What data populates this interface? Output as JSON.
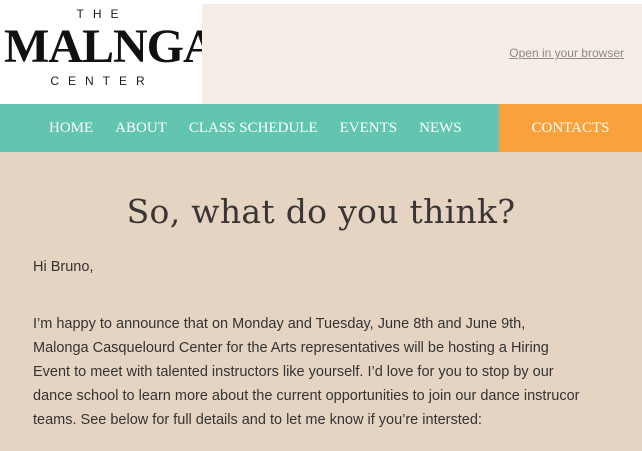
{
  "header": {
    "logo": {
      "top_text": "THE",
      "main_left": "MAL",
      "main_right": "NGA",
      "bottom_text": "CENTER"
    },
    "browser_link": "Open in your browser"
  },
  "nav": {
    "items": [
      {
        "label": "HOME"
      },
      {
        "label": "ABOUT"
      },
      {
        "label": "CLASS SCHEDULE"
      },
      {
        "label": "EVENTS"
      },
      {
        "label": "NEWS"
      }
    ],
    "contacts": "CONTACTS"
  },
  "content": {
    "headline": "So, what do you think?",
    "greeting": "Hi Bruno,",
    "body_lines": [
      "I’m happy to announce that on Monday and Tuesday, June 8th and June 9th,",
      "Malonga Casquelourd Center for the Arts representatives will be hosting a Hiring",
      "Event to meet with talented instructors like yourself. I’d love for you to stop by our",
      "dance school to learn more about the current opportunities to join our dance instrucor",
      "teams. See below for full details and to let me know if you’re intersted:"
    ]
  },
  "colors": {
    "nav_bg": "#62c5b0",
    "contacts_bg": "#f9a13a",
    "header_bg": "#f6ede6",
    "content_bg": "#e6d4c2",
    "mandala": "#3aaab8"
  }
}
